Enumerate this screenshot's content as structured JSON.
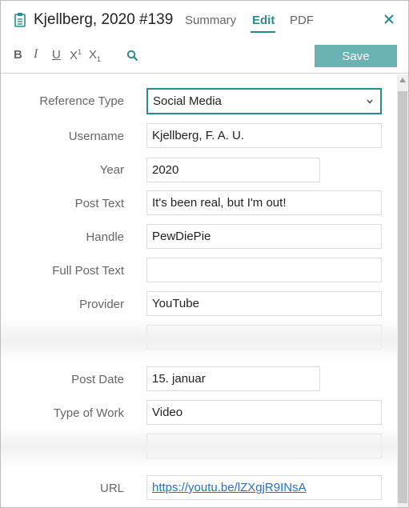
{
  "header": {
    "title": "Kjellberg, 2020 #139",
    "tabs": {
      "summary": "Summary",
      "edit": "Edit",
      "pdf": "PDF"
    },
    "active_tab": "Edit",
    "icons": {
      "document": "clipboard-icon",
      "close": "close-icon",
      "search": "search-icon"
    },
    "accent_color": "#2b8a8a"
  },
  "toolbar": {
    "bold": "B",
    "italic": "I",
    "underline": "U",
    "superscript_base": "X",
    "superscript_mark": "1",
    "subscript_base": "X",
    "subscript_mark": "1",
    "save_label": "Save",
    "save_color": "#6bb3b3"
  },
  "form": {
    "reference_type": {
      "label": "Reference Type",
      "value": "Social Media"
    },
    "username": {
      "label": "Username",
      "value": "Kjellberg, F. A. U."
    },
    "year": {
      "label": "Year",
      "value": "2020"
    },
    "post_text": {
      "label": "Post Text",
      "value": "It's been real, but I'm out!"
    },
    "handle": {
      "label": "Handle",
      "value": "PewDiePie"
    },
    "full_post_text": {
      "label": "Full Post Text",
      "value": ""
    },
    "provider": {
      "label": "Provider",
      "value": "YouTube"
    },
    "post_date": {
      "label": "Post Date",
      "value": "15. januar"
    },
    "type_of_work": {
      "label": "Type of Work",
      "value": "Video"
    },
    "url": {
      "label": "URL",
      "value": "https://youtu.be/lZXgjR9INsA"
    }
  }
}
